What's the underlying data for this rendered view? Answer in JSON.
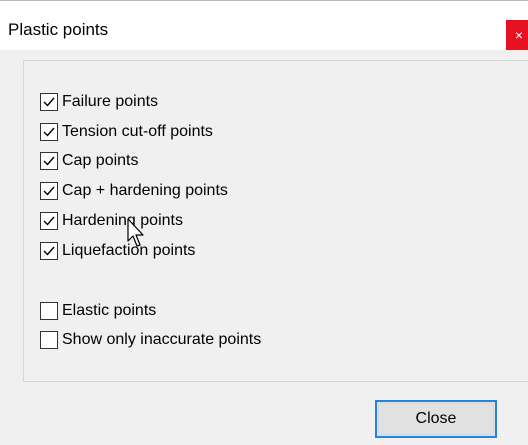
{
  "dialog": {
    "title": "Plastic points",
    "close_glyph": "×"
  },
  "checkboxes_group1": [
    {
      "label": "Failure points",
      "checked": true
    },
    {
      "label": "Tension cut-off points",
      "checked": true
    },
    {
      "label": "Cap points",
      "checked": true
    },
    {
      "label": "Cap + hardening points",
      "checked": true
    },
    {
      "label": "Hardening points",
      "checked": true
    },
    {
      "label": "Liquefaction points",
      "checked": true
    }
  ],
  "checkboxes_group2": [
    {
      "label": "Elastic points",
      "checked": false
    },
    {
      "label": "Show only inaccurate points",
      "checked": false
    }
  ],
  "buttons": {
    "close_label": "Close"
  },
  "colors": {
    "title_close_bg": "#e81123",
    "focus_border": "#2a82da",
    "dialog_bg": "#f0f0f0"
  },
  "icons": {
    "check": "checkmark-icon",
    "cursor": "mouse-pointer-icon"
  }
}
